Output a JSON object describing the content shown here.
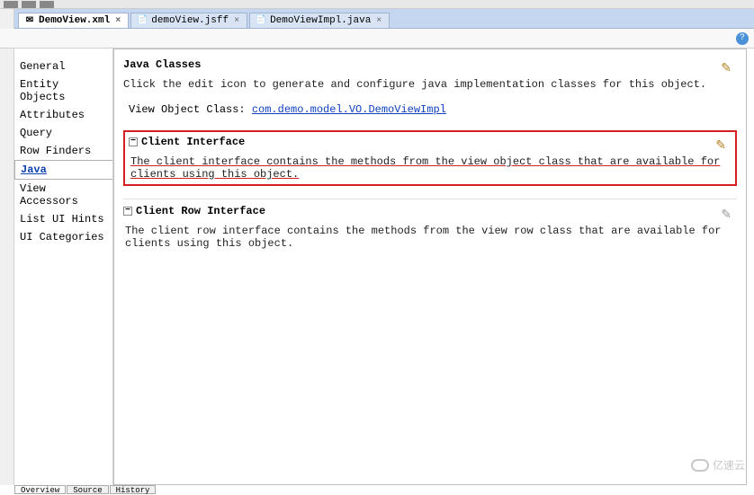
{
  "tabs": [
    {
      "label": "DemoView.xml",
      "active": true
    },
    {
      "label": "demoView.jsff",
      "active": false
    },
    {
      "label": "DemoViewImpl.java",
      "active": false
    }
  ],
  "help_icon": "?",
  "sidebar": {
    "items": [
      "General",
      "Entity Objects",
      "Attributes",
      "Query",
      "Row Finders",
      "Java",
      "View Accessors",
      "List UI Hints",
      "UI Categories"
    ],
    "active": "Java"
  },
  "main": {
    "java_classes": {
      "heading": "Java Classes",
      "desc": "Click the edit icon to generate and configure java implementation classes for this object.",
      "voc_label": "View Object Class: ",
      "voc_link": "com.demo.model.VO.DemoViewImpl"
    },
    "client_interface": {
      "heading": "Client Interface",
      "desc": "The client interface contains the methods from the view object class that are available for clients using this object."
    },
    "client_row_interface": {
      "heading": "Client Row Interface",
      "desc": "The client row interface contains the methods from the view row class that are available for clients using this object."
    }
  },
  "bottom_tabs": [
    "Overview",
    "Source",
    "History"
  ],
  "watermark": "亿速云",
  "collapse_glyph": "−"
}
